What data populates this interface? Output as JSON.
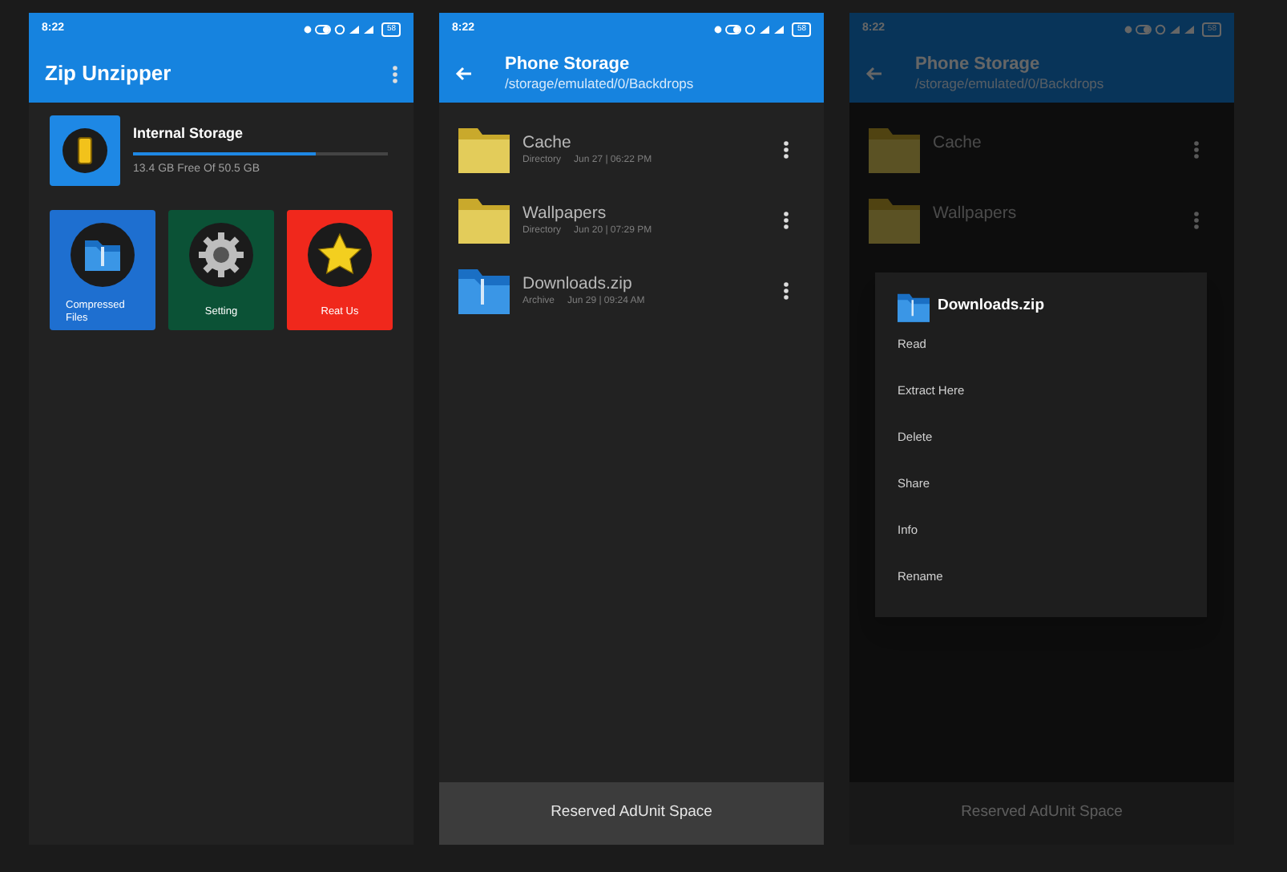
{
  "screens": [
    {
      "kind": "home",
      "status_time": "8:22",
      "battery": "58",
      "title": "Zip Unzipper",
      "dimmed": false,
      "storage": {
        "title": "Internal Storage",
        "level": 0.72,
        "reading": "13.4 GB Free Of 50.5 GB"
      },
      "tiles": [
        {
          "kind": "folder",
          "label": "Compressed Files",
          "color": "#1e6fd0"
        },
        {
          "kind": "gear",
          "label": "Setting",
          "color": "#0b5236"
        },
        {
          "kind": "star",
          "label": "Reat Us",
          "color": "#f0281c"
        }
      ]
    },
    {
      "kind": "browser",
      "status_time": "8:22",
      "battery": "58",
      "title": "Phone Storage",
      "path": "/storage/emulated/0/Backdrops",
      "dimmed": false,
      "files": [
        {
          "kind": "folder",
          "name": "Cache",
          "type": "Directory",
          "date": "Jun 27 | 06:22 PM"
        },
        {
          "kind": "folder",
          "name": "Wallpapers",
          "type": "Directory",
          "date": "Jun 20 | 07:29 PM"
        },
        {
          "kind": "zip",
          "name": "Downloads.zip",
          "type": "Archive",
          "date": "Jun 29 | 09:24 AM"
        }
      ],
      "ad": "Reserved AdUnit Space"
    },
    {
      "kind": "browser",
      "status_time": "8:22",
      "battery": "58",
      "title": "Phone Storage",
      "path": "/storage/emulated/0/Backdrops",
      "dimmed": true,
      "files": [
        {
          "kind": "folder",
          "name": "Cache"
        },
        {
          "kind": "folder",
          "name": "Wallpapers"
        }
      ],
      "ad": "Reserved AdUnit Space",
      "menu": {
        "title": "Downloads.zip",
        "items": [
          "Read",
          "Extract Here",
          "Delete",
          "Share",
          "Info",
          "Rename"
        ]
      }
    }
  ]
}
